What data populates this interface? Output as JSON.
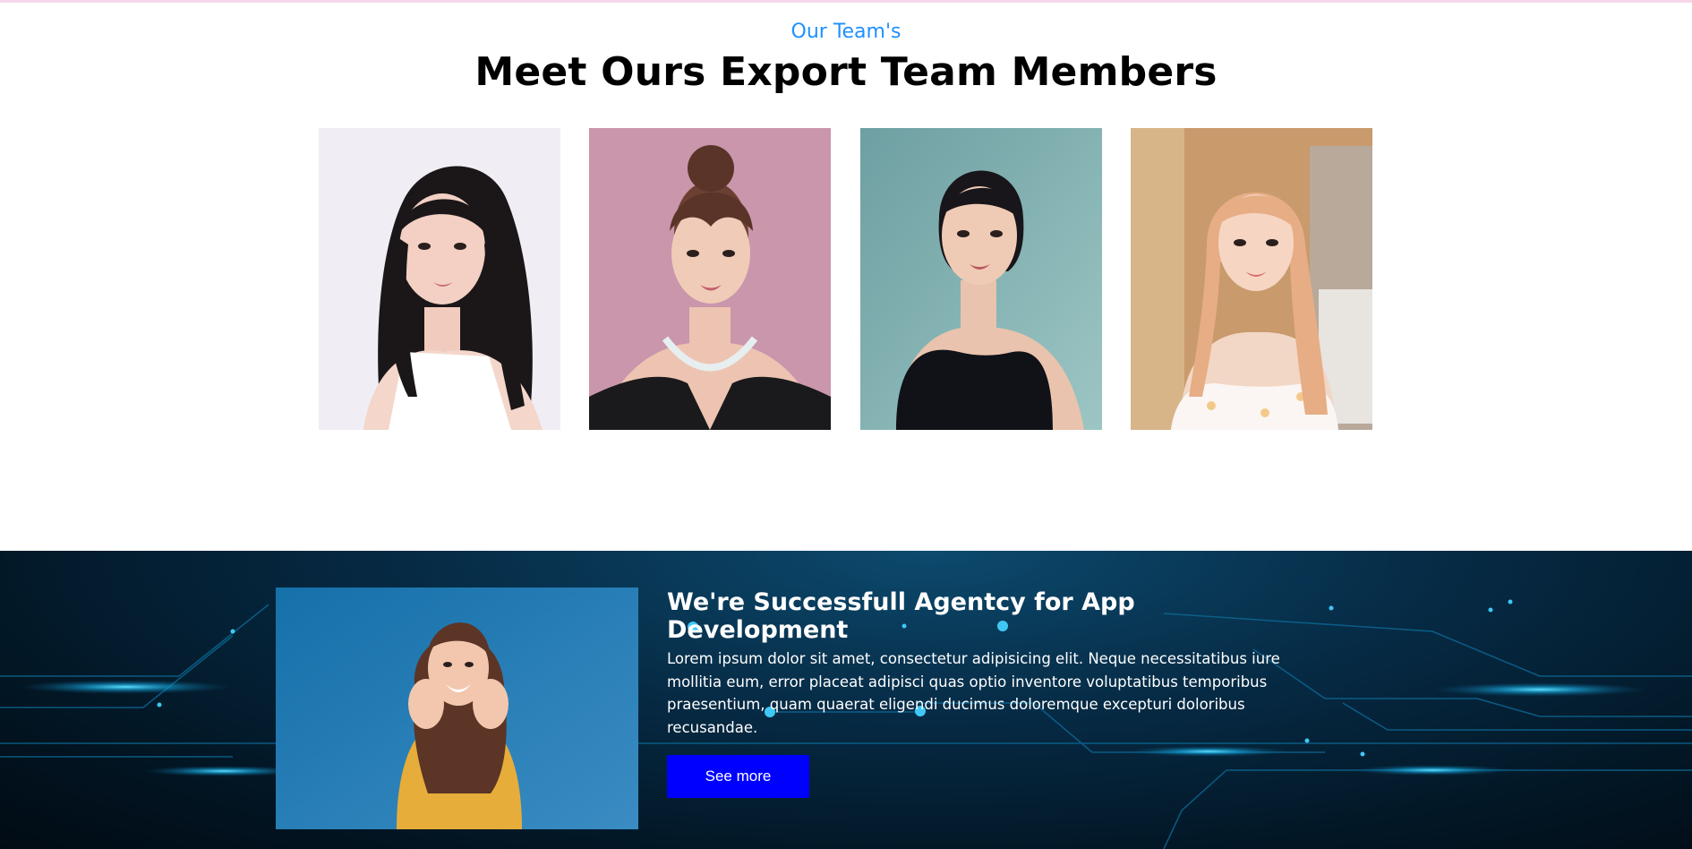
{
  "team": {
    "kicker": "Our Team's",
    "title": "Meet Ours Export Team Members",
    "members": [
      {
        "image": "team-member-photo-1"
      },
      {
        "image": "team-member-photo-2"
      },
      {
        "image": "team-member-photo-3"
      },
      {
        "image": "team-member-photo-4"
      }
    ]
  },
  "agency": {
    "heading": "We're Successfull Agentcy for App Development",
    "body": "Lorem ipsum dolor sit amet, consectetur adipisicing elit. Neque necessitatibus iure mollitia eum, error placeat adipisci quas optio inventore voluptatibus temporibus praesentium, quam quaerat eligendi ducimus doloremque excepturi doloribus recusandae.",
    "button_label": "See more",
    "image": "agency-photo"
  },
  "colors": {
    "kicker": "#1e90ff",
    "button": "#0000ff",
    "dark_background": "#021624",
    "circuit_glow": "#29c6ff"
  }
}
